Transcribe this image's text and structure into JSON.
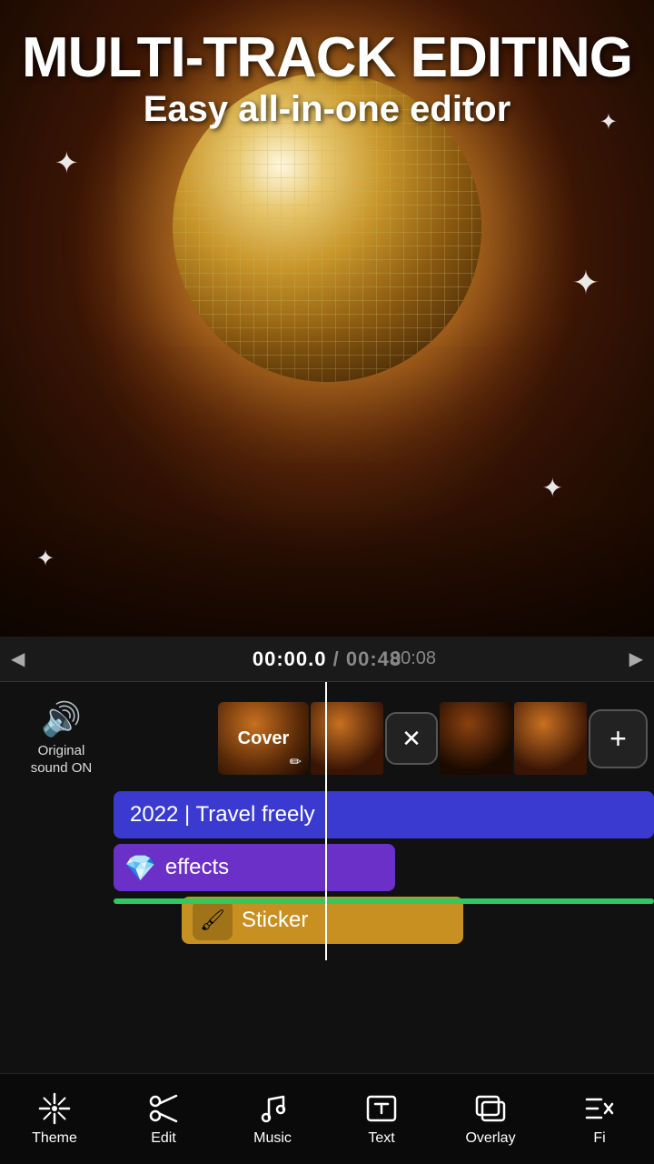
{
  "header": {
    "title_main": "MULTI-TRACK EDITING",
    "title_sub": "Easy all-in-one editor"
  },
  "timeline": {
    "current_time": "00:00",
    "current_time_fraction": ".0",
    "divider": "/",
    "total_time": "00:48",
    "marker_time": "00:08",
    "playhead_visible": true
  },
  "tracks": {
    "original_sound": {
      "label_line1": "Original",
      "label_line2": "sound ON"
    },
    "cover_clip": {
      "label": "Cover"
    },
    "text_track": {
      "content": "2022 | Travel freely"
    },
    "effects_track": {
      "label": "effects"
    },
    "sticker_track": {
      "label": "Sticker"
    }
  },
  "toolbar": {
    "items": [
      {
        "id": "theme",
        "label": "Theme",
        "icon": "sparkle"
      },
      {
        "id": "edit",
        "label": "Edit",
        "icon": "scissors"
      },
      {
        "id": "music",
        "label": "Music",
        "icon": "music-note"
      },
      {
        "id": "text",
        "label": "Text",
        "icon": "text-box"
      },
      {
        "id": "overlay",
        "label": "Overlay",
        "icon": "overlay"
      },
      {
        "id": "fx",
        "label": "Fi",
        "icon": "fx"
      }
    ]
  }
}
